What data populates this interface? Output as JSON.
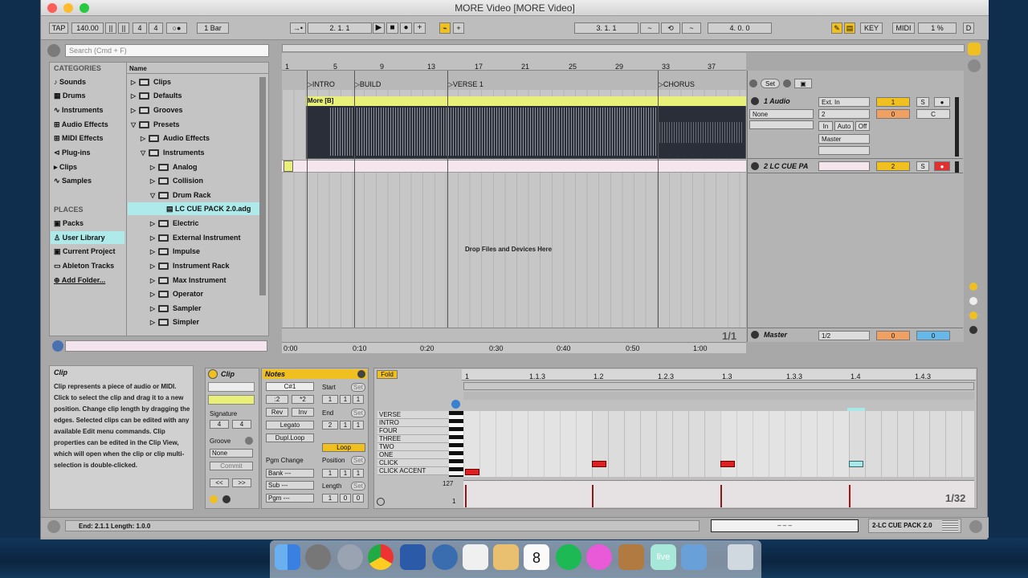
{
  "window": {
    "title": "MORE Video  [MORE Video]"
  },
  "transport": {
    "tap": "TAP",
    "tempo": "140.00",
    "sig_num": "4",
    "sig_den": "4",
    "metro": "○●",
    "quantize": "1 Bar",
    "arr_position": "2.   1.   1",
    "punch_in": "3.   1.   1",
    "loop_len": "4.   0.   0",
    "key": "KEY",
    "midi": "MIDI",
    "cpu": "1 %",
    "d": "D"
  },
  "browser": {
    "search_placeholder": "Search (Cmd + F)",
    "categories_header": "CATEGORIES",
    "categories": [
      "Sounds",
      "Drums",
      "Instruments",
      "Audio Effects",
      "MIDI Effects",
      "Plug-ins",
      "Clips",
      "Samples"
    ],
    "places_header": "PLACES",
    "places": [
      "Packs",
      "User Library",
      "Current Project",
      "Ableton Tracks",
      "Add Folder..."
    ],
    "name_header": "Name",
    "items": [
      "Clips",
      "Defaults",
      "Grooves",
      "Presets",
      "Audio Effects",
      "Instruments",
      "Analog",
      "Collision",
      "Drum Rack",
      "LC CUE PACK 2.0.adg",
      "Electric",
      "External Instrument",
      "Impulse",
      "Instrument Rack",
      "Max Instrument",
      "Operator",
      "Sampler",
      "Simpler"
    ]
  },
  "arrangement": {
    "bar_numbers": [
      "1",
      "5",
      "9",
      "13",
      "17",
      "21",
      "25",
      "29",
      "33",
      "37"
    ],
    "locators": [
      "INTRO",
      "BUILD",
      "VERSE 1",
      "CHORUS"
    ],
    "clip_name": "More [B]",
    "drop_text": "Drop Files and Devices Here",
    "zoom": "1/1",
    "times": [
      "0:00",
      "0:10",
      "0:20",
      "0:30",
      "0:40",
      "0:50",
      "1:00"
    ],
    "set_label": "Set"
  },
  "tracks": {
    "audio": {
      "name": "1 Audio",
      "input": "Ext. In",
      "none": "None",
      "chan": "2",
      "in": "In",
      "auto": "Auto",
      "off": "Off",
      "out": "Master",
      "num": "1",
      "vol": "0",
      "pan": "C",
      "s": "S"
    },
    "midi": {
      "name": "2 LC CUE PA",
      "num": "2",
      "s": "S"
    },
    "master": {
      "name": "Master",
      "cue": "1/2",
      "vol": "0",
      "vol2": "0"
    }
  },
  "info": {
    "title": "Clip",
    "text": "Clip represents a piece of audio or MIDI. Click to select the clip and drag it to a new position. Change clip length by dragging the edges. Selected clips can be edited with any available Edit menu commands. Clip properties can be edited in the Clip View, which will open when the clip or clip multi-selection is double-clicked."
  },
  "clipview": {
    "clip_title": "Clip",
    "signature_label": "Signature",
    "sig_num": "4",
    "sig_den": "4",
    "groove_label": "Groove",
    "groove_value": "None",
    "commit": "Commit",
    "notes_title": "Notes",
    "note_value": "C#1",
    "half": ":2",
    "double": "*2",
    "rev": "Rev",
    "inv": "Inv",
    "legato": "Legato",
    "dupl": "Dupl.Loop",
    "pgm_change": "Pgm Change",
    "bank": "Bank ---",
    "sub": "Sub ---",
    "pgm": "Pgm ---",
    "start_label": "Start",
    "end_label": "End",
    "loop": "Loop",
    "position_label": "Position",
    "length_label": "Length",
    "set": "Set",
    "start_vals": [
      "1",
      "1",
      "1"
    ],
    "end_vals": [
      "2",
      "1",
      "1"
    ],
    "pos_vals": [
      "1",
      "1",
      "1"
    ],
    "len_vals": [
      "1",
      "0",
      "0"
    ],
    "prev": "<<",
    "next": ">>"
  },
  "piano": {
    "fold": "Fold",
    "ruler": [
      "1",
      "1.1.3",
      "1.2",
      "1.2.3",
      "1.3",
      "1.3.3",
      "1.4",
      "1.4.3"
    ],
    "keys": [
      "VERSE",
      "INTRO",
      "FOUR",
      "THREE",
      "TWO",
      "ONE",
      "CLICK",
      "CLICK ACCENT"
    ],
    "vel_max": "127",
    "vel_min": "1",
    "grid": "1/32"
  },
  "status": {
    "text": "End: 2.1.1  Length: 1.0.0",
    "mid": "–          –          –",
    "device": "2-LC CUE PACK 2.0"
  },
  "colors": {
    "clip": "#e8f07a",
    "accent": "#f0c020",
    "note_red": "#e02020",
    "note_cyan": "#a8e8e8",
    "cue": "#a8f0e8"
  }
}
